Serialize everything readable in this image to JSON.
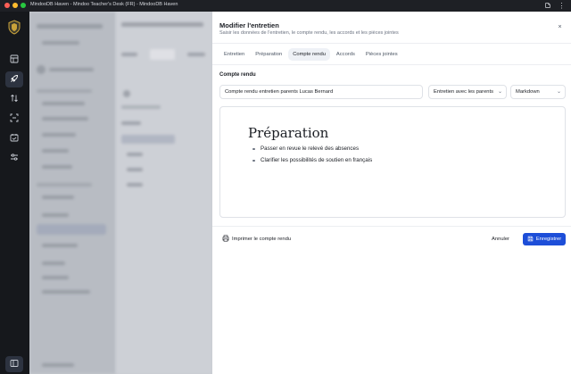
{
  "window": {
    "title": "MindooDB Haven - Mindoo Teacher's Desk (FR) - MindooDB Haven"
  },
  "rail": {
    "items": [
      {
        "icon": "dashboard-icon"
      },
      {
        "icon": "rocket-icon",
        "active": true
      },
      {
        "icon": "sort-arrows-icon"
      },
      {
        "icon": "scan-icon"
      },
      {
        "icon": "calendar-check-icon"
      },
      {
        "icon": "sliders-icon"
      }
    ],
    "bottom_icon": "panel-toggle-icon"
  },
  "modal": {
    "title": "Modifier l'entretien",
    "subtitle": "Saisir les données de l'entretien, le compte rendu, les accords et les pièces jointes",
    "close_label": "×",
    "tabs": [
      {
        "label": "Entretien"
      },
      {
        "label": "Préparation"
      },
      {
        "label": "Compte rendu",
        "active": true
      },
      {
        "label": "Accords"
      },
      {
        "label": "Pièces jointes"
      }
    ],
    "section_label": "Compte rendu",
    "report_title_value": "Compte rendu entretien parents Lucas Bernard",
    "template_select": "Entretien avec les parents",
    "format_select": "Markdown",
    "editor": {
      "heading": "Préparation",
      "bullets": [
        "Passer en revue le relevé des absences",
        "Clarifier les possibilités de soutien en français"
      ]
    },
    "footer": {
      "print_label": "Imprimer le compte rendu",
      "cancel_label": "Annuler",
      "save_label": "Enregistrer"
    }
  },
  "colors": {
    "accent": "#1d4ed8",
    "rail_bg": "#16181c",
    "panel_bg": "#ffffff"
  }
}
